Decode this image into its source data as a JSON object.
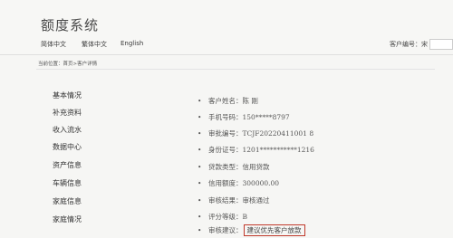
{
  "header": {
    "title": "额度系统",
    "languages": [
      "简体中文",
      "繁体中文",
      "English"
    ],
    "user_label": "客户编号：宋"
  },
  "breadcrumb": "当前位置：首页>客户详情",
  "sidebar": {
    "items": [
      "基本情况",
      "补充资料",
      "收入流水",
      "数据中心",
      "资产信息",
      "车辆信息",
      "家庭信息",
      "家庭情况"
    ]
  },
  "details": [
    {
      "label": "客户姓名：",
      "value": "陈 刚"
    },
    {
      "label": "手机号码：",
      "value": "150*****8797"
    },
    {
      "label": "审批编号：",
      "value": "TCJF20220411001 8"
    },
    {
      "label": "身份证号：",
      "value": "1201***********1216"
    },
    {
      "label": "贷款类型：",
      "value": "信用贷款"
    },
    {
      "label": "信用额度：",
      "value": "300000.00"
    },
    {
      "label": "审核结果：",
      "value": "审核通过"
    },
    {
      "label": "评分等级：",
      "value": "B"
    },
    {
      "label": "审核建议：",
      "value": "建议优先客户放款",
      "highlight": true
    }
  ]
}
